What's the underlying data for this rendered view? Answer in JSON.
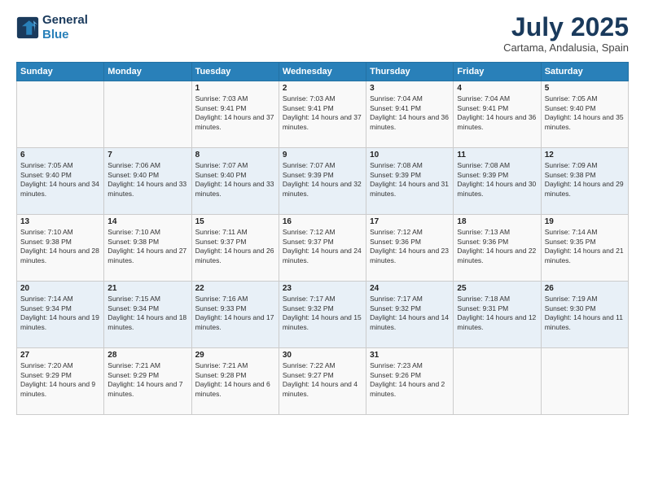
{
  "logo": {
    "line1": "General",
    "line2": "Blue"
  },
  "title": "July 2025",
  "subtitle": "Cartama, Andalusia, Spain",
  "days_header": [
    "Sunday",
    "Monday",
    "Tuesday",
    "Wednesday",
    "Thursday",
    "Friday",
    "Saturday"
  ],
  "weeks": [
    [
      {
        "day": "",
        "content": ""
      },
      {
        "day": "",
        "content": ""
      },
      {
        "day": "1",
        "content": "Sunrise: 7:03 AM\nSunset: 9:41 PM\nDaylight: 14 hours and 37 minutes."
      },
      {
        "day": "2",
        "content": "Sunrise: 7:03 AM\nSunset: 9:41 PM\nDaylight: 14 hours and 37 minutes."
      },
      {
        "day": "3",
        "content": "Sunrise: 7:04 AM\nSunset: 9:41 PM\nDaylight: 14 hours and 36 minutes."
      },
      {
        "day": "4",
        "content": "Sunrise: 7:04 AM\nSunset: 9:41 PM\nDaylight: 14 hours and 36 minutes."
      },
      {
        "day": "5",
        "content": "Sunrise: 7:05 AM\nSunset: 9:40 PM\nDaylight: 14 hours and 35 minutes."
      }
    ],
    [
      {
        "day": "6",
        "content": "Sunrise: 7:05 AM\nSunset: 9:40 PM\nDaylight: 14 hours and 34 minutes."
      },
      {
        "day": "7",
        "content": "Sunrise: 7:06 AM\nSunset: 9:40 PM\nDaylight: 14 hours and 33 minutes."
      },
      {
        "day": "8",
        "content": "Sunrise: 7:07 AM\nSunset: 9:40 PM\nDaylight: 14 hours and 33 minutes."
      },
      {
        "day": "9",
        "content": "Sunrise: 7:07 AM\nSunset: 9:39 PM\nDaylight: 14 hours and 32 minutes."
      },
      {
        "day": "10",
        "content": "Sunrise: 7:08 AM\nSunset: 9:39 PM\nDaylight: 14 hours and 31 minutes."
      },
      {
        "day": "11",
        "content": "Sunrise: 7:08 AM\nSunset: 9:39 PM\nDaylight: 14 hours and 30 minutes."
      },
      {
        "day": "12",
        "content": "Sunrise: 7:09 AM\nSunset: 9:38 PM\nDaylight: 14 hours and 29 minutes."
      }
    ],
    [
      {
        "day": "13",
        "content": "Sunrise: 7:10 AM\nSunset: 9:38 PM\nDaylight: 14 hours and 28 minutes."
      },
      {
        "day": "14",
        "content": "Sunrise: 7:10 AM\nSunset: 9:38 PM\nDaylight: 14 hours and 27 minutes."
      },
      {
        "day": "15",
        "content": "Sunrise: 7:11 AM\nSunset: 9:37 PM\nDaylight: 14 hours and 26 minutes."
      },
      {
        "day": "16",
        "content": "Sunrise: 7:12 AM\nSunset: 9:37 PM\nDaylight: 14 hours and 24 minutes."
      },
      {
        "day": "17",
        "content": "Sunrise: 7:12 AM\nSunset: 9:36 PM\nDaylight: 14 hours and 23 minutes."
      },
      {
        "day": "18",
        "content": "Sunrise: 7:13 AM\nSunset: 9:36 PM\nDaylight: 14 hours and 22 minutes."
      },
      {
        "day": "19",
        "content": "Sunrise: 7:14 AM\nSunset: 9:35 PM\nDaylight: 14 hours and 21 minutes."
      }
    ],
    [
      {
        "day": "20",
        "content": "Sunrise: 7:14 AM\nSunset: 9:34 PM\nDaylight: 14 hours and 19 minutes."
      },
      {
        "day": "21",
        "content": "Sunrise: 7:15 AM\nSunset: 9:34 PM\nDaylight: 14 hours and 18 minutes."
      },
      {
        "day": "22",
        "content": "Sunrise: 7:16 AM\nSunset: 9:33 PM\nDaylight: 14 hours and 17 minutes."
      },
      {
        "day": "23",
        "content": "Sunrise: 7:17 AM\nSunset: 9:32 PM\nDaylight: 14 hours and 15 minutes."
      },
      {
        "day": "24",
        "content": "Sunrise: 7:17 AM\nSunset: 9:32 PM\nDaylight: 14 hours and 14 minutes."
      },
      {
        "day": "25",
        "content": "Sunrise: 7:18 AM\nSunset: 9:31 PM\nDaylight: 14 hours and 12 minutes."
      },
      {
        "day": "26",
        "content": "Sunrise: 7:19 AM\nSunset: 9:30 PM\nDaylight: 14 hours and 11 minutes."
      }
    ],
    [
      {
        "day": "27",
        "content": "Sunrise: 7:20 AM\nSunset: 9:29 PM\nDaylight: 14 hours and 9 minutes."
      },
      {
        "day": "28",
        "content": "Sunrise: 7:21 AM\nSunset: 9:29 PM\nDaylight: 14 hours and 7 minutes."
      },
      {
        "day": "29",
        "content": "Sunrise: 7:21 AM\nSunset: 9:28 PM\nDaylight: 14 hours and 6 minutes."
      },
      {
        "day": "30",
        "content": "Sunrise: 7:22 AM\nSunset: 9:27 PM\nDaylight: 14 hours and 4 minutes."
      },
      {
        "day": "31",
        "content": "Sunrise: 7:23 AM\nSunset: 9:26 PM\nDaylight: 14 hours and 2 minutes."
      },
      {
        "day": "",
        "content": ""
      },
      {
        "day": "",
        "content": ""
      }
    ]
  ]
}
